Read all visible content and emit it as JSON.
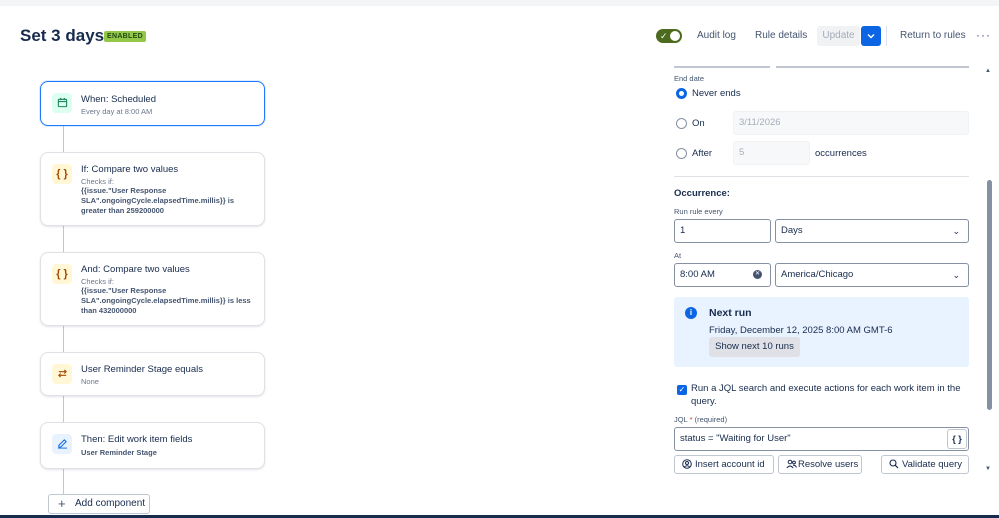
{
  "header": {
    "title": "Set 3 days",
    "status_badge": "ENABLED",
    "audit_log": "Audit log",
    "rule_details": "Rule details",
    "update": "Update",
    "return_to_rules": "Return to rules",
    "more": "···"
  },
  "flow": {
    "trigger": {
      "title": "When: Scheduled",
      "subtitle": "Every day at 8:00 AM",
      "icon": "calendar-icon"
    },
    "condition1": {
      "title": "If: Compare two values",
      "checks_label": "Checks if:",
      "detail": "{{issue.\"User Response SLA\".ongoingCycle.elapsedTime.millis}} is greater than 259200000",
      "icon": "braces-icon"
    },
    "condition2": {
      "title": "And: Compare two values",
      "checks_label": "Checks if:",
      "detail": "{{issue.\"User Response SLA\".ongoingCycle.elapsedTime.millis}} is less than 432000000",
      "icon": "braces-icon"
    },
    "condition3": {
      "title": "User Reminder Stage equals",
      "subtitle": "None",
      "icon": "swap-icon"
    },
    "action": {
      "title": "Then: Edit work item fields",
      "subtitle": "User Reminder Stage",
      "icon": "edit-icon"
    },
    "add_component": "Add component"
  },
  "panel": {
    "end_date_label": "End date",
    "never_ends": "Never ends",
    "on_label": "On",
    "on_date": "3/11/2026",
    "after_label": "After",
    "after_count": "5",
    "occurrences": "occurrences",
    "occurrence_heading": "Occurrence:",
    "run_every_label": "Run rule every",
    "run_every_value": "1",
    "run_every_unit": "Days",
    "at_label": "At",
    "at_time": "8:00 AM",
    "timezone": "America/Chicago",
    "next_run_title": "Next run",
    "next_run_value": "Friday, December 12, 2025 8:00 AM GMT-6",
    "show_next": "Show next 10 runs",
    "jql_checkbox_text": "Run a JQL search and execute actions for each work item in the query.",
    "jql_label": "JQL",
    "jql_required": "(required)",
    "jql_value": "status = \"Waiting for User\"",
    "insert_account": "Insert account id",
    "resolve_users": "Resolve users",
    "validate_query": "Validate query"
  },
  "colors": {
    "accent": "#0c66e4",
    "enabled_badge": "#94c748",
    "toggle_on": "#4c6b1f",
    "next_run_bg": "#e9f2ff"
  }
}
